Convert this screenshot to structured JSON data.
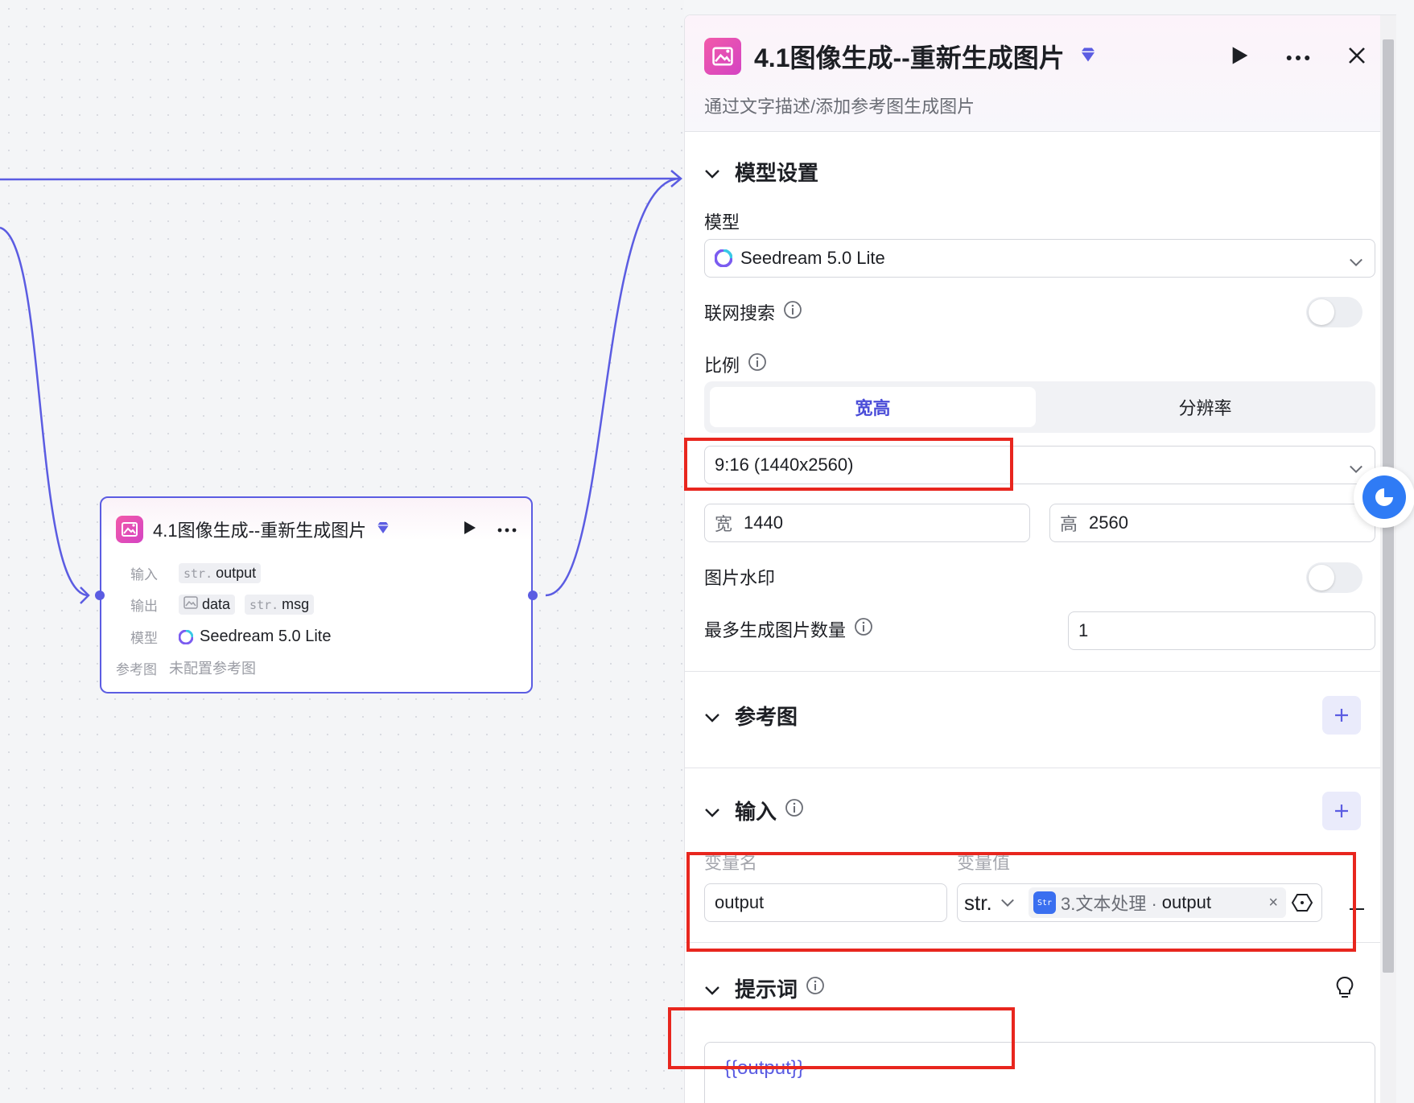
{
  "node": {
    "title": "4.1图像生成--重新生成图片",
    "input_label": "输入",
    "input_chip_type": "str.",
    "input_chip_name": "output",
    "output_label": "输出",
    "output_chip1_name": "data",
    "output_chip2_type": "str.",
    "output_chip2_name": "msg",
    "model_label": "模型",
    "model_value": "Seedream 5.0 Lite",
    "ref_label": "参考图",
    "ref_value": "未配置参考图"
  },
  "panel": {
    "title": "4.1图像生成--重新生成图片",
    "subtitle": "通过文字描述/添加参考图生成图片",
    "model_section": {
      "title": "模型设置",
      "model_label": "模型",
      "model_value": "Seedream 5.0 Lite",
      "web_search_label": "联网搜索",
      "web_search_on": false,
      "ratio_label": "比例",
      "tabs": [
        "宽高",
        "分辨率"
      ],
      "active_tab": "宽高",
      "ratio_value": "9:16 (1440x2560)",
      "width_prefix": "宽",
      "width_value": "1440",
      "height_prefix": "高",
      "height_value": "2560",
      "watermark_label": "图片水印",
      "watermark_on": false,
      "max_count_label": "最多生成图片数量",
      "max_count_value": "1"
    },
    "ref_section": {
      "title": "参考图"
    },
    "input_section": {
      "title": "输入",
      "col_name": "变量名",
      "col_value": "变量值",
      "var_name": "output",
      "var_type": "str.",
      "ref_source": "3.文本处理 ·",
      "ref_var": "output",
      "remove_label": "×"
    },
    "prompt_section": {
      "title": "提示词",
      "value": "{{output}}"
    }
  },
  "colors": {
    "accent": "#5b5ce2",
    "highlight_box": "#e8261e",
    "app_icon": "#e14bb9"
  }
}
